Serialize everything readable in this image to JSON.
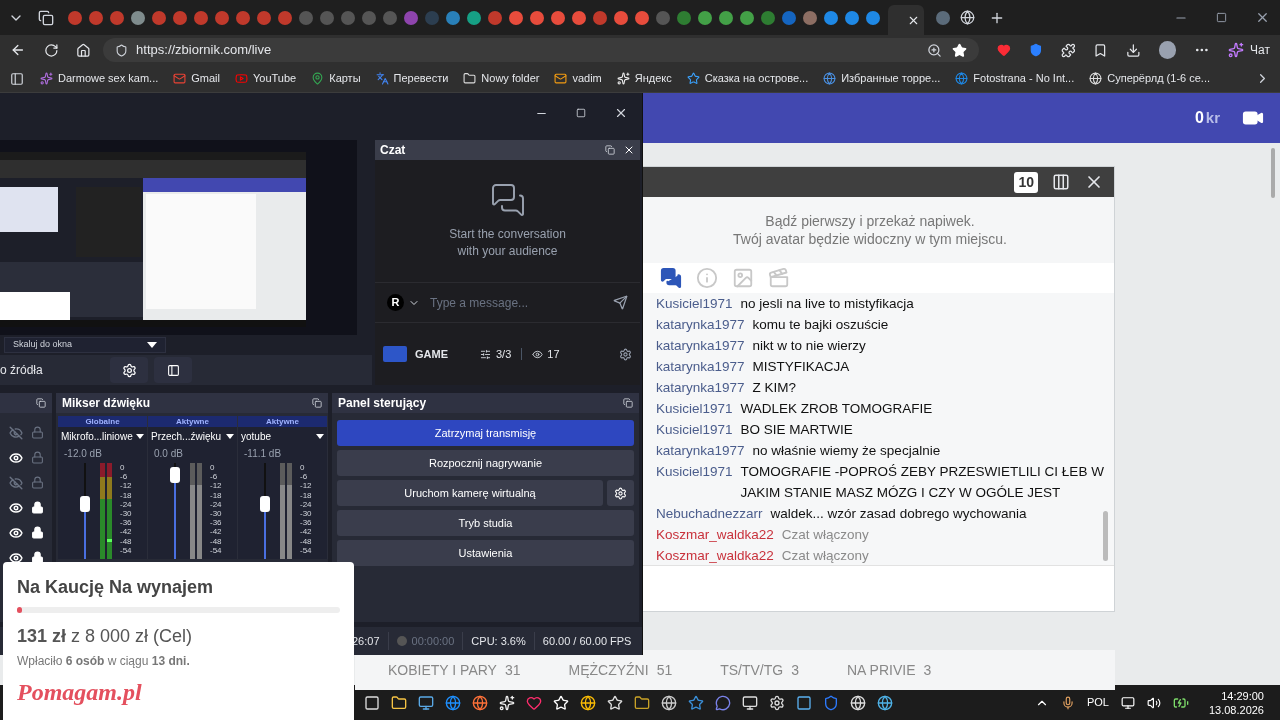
{
  "address_bar": {
    "url": "https://zbiornik.com/live"
  },
  "chat_button": {
    "label": "Чат"
  },
  "bookmarks": [
    {
      "label": "Darmowe sex kam..."
    },
    {
      "label": "Gmail"
    },
    {
      "label": "YouTube"
    },
    {
      "label": "Карты"
    },
    {
      "label": "Перевести"
    },
    {
      "label": "Nowy folder"
    },
    {
      "label": "vadim"
    },
    {
      "label": "Яндекс"
    },
    {
      "label": "Сказка на острове..."
    },
    {
      "label": "Избранные торре..."
    },
    {
      "label": "Fotostrana - No Int..."
    },
    {
      "label": "Суперёрлд (1-6 се..."
    }
  ],
  "page": {
    "header": {
      "balance": "0",
      "currency": "kr"
    },
    "chat_widget": {
      "badge": "10",
      "tip_lines": [
        "Bądź pierwszy i przekaż napiwek.",
        "Twój avatar będzie widoczny w tym miejscu."
      ],
      "tabs": [
        {
          "kind": "chat",
          "selected": true
        },
        {
          "kind": "info",
          "selected": false
        },
        {
          "kind": "image",
          "selected": false
        },
        {
          "kind": "video",
          "selected": false
        }
      ],
      "messages": [
        {
          "kind": "chat",
          "user": "Kusiciel1971",
          "color": "#4b5d8c",
          "text": "no jesli na live to mistyfikacja"
        },
        {
          "kind": "chat",
          "user": "katarynka1977",
          "color": "#4b5d8c",
          "text": "komu te bajki oszuście"
        },
        {
          "kind": "chat",
          "user": "katarynka1977",
          "color": "#4b5d8c",
          "text": "nikt w to nie wierzy"
        },
        {
          "kind": "chat",
          "user": "katarynka1977",
          "color": "#4b5d8c",
          "text": "MISTYFIKACJA"
        },
        {
          "kind": "chat",
          "user": "katarynka1977",
          "color": "#4b5d8c",
          "text": "Z KIM?"
        },
        {
          "kind": "chat",
          "user": "Kusiciel1971",
          "color": "#4b5d8c",
          "text": "WADLEK ZROB TOMOGRAFIE"
        },
        {
          "kind": "chat",
          "user": "Kusiciel1971",
          "color": "#4b5d8c",
          "text": "BO SIE MARTWIE"
        },
        {
          "kind": "chat",
          "user": "katarynka1977",
          "color": "#4b5d8c",
          "text": "no właśnie wiemy że specjalnie"
        },
        {
          "kind": "chat",
          "user": "Kusiciel1971",
          "color": "#4b5d8c",
          "text": "TOMOGRAFIE -POPROŚ ZEBY PRZESWIETLILI CI ŁEB W JAKIM STANIE MASZ MÓZG I CZY W OGÓLE JEST"
        },
        {
          "kind": "chat",
          "user": "Nebuchadnezzarr",
          "color": "#4b5d8c",
          "text": "waldek... wzór zasad dobrego wychowania"
        },
        {
          "kind": "system",
          "user": "Koszmar_waldka22",
          "color": "#c8323c",
          "text": "Czat włączony"
        },
        {
          "kind": "system",
          "user": "Koszmar_waldka22",
          "color": "#c8323c",
          "text": "Czat włączony"
        }
      ]
    },
    "categories": [
      {
        "label": "KOBIETY I PARY",
        "count": "31"
      },
      {
        "label": "MĘŻCZYŹNI",
        "count": "51"
      },
      {
        "label": "TS/TV/TG",
        "count": "3"
      },
      {
        "label": "NA PRIVIE",
        "count": "3"
      }
    ]
  },
  "obs": {
    "scale_mode": "Skaluj do okna",
    "source_label": "o źródła",
    "chat_dock": {
      "title": "Czat",
      "empty_lines": [
        "Start the conversation",
        "with your audience"
      ],
      "avatar": "R",
      "placeholder": "Type a message...",
      "channel": "GAME",
      "streams": "3/3",
      "viewers": "17"
    },
    "sources": [
      {
        "visible": false,
        "locked": false
      },
      {
        "visible": true,
        "locked": false
      },
      {
        "visible": false,
        "locked": false
      },
      {
        "visible": true,
        "locked": true
      },
      {
        "visible": true,
        "locked": true
      },
      {
        "visible": true,
        "locked": true
      }
    ],
    "mixer": {
      "title": "Mikser dźwięku",
      "channels": [
        {
          "group": "Globalne",
          "name": "Mikrofo...liniowe",
          "db": "-12.0 dB",
          "level": 0.6,
          "meter_lit": true,
          "scale": [
            "0",
            "-6",
            "-12",
            "-18",
            "-24",
            "-30",
            "-36",
            "-42",
            "-48",
            "-54"
          ]
        },
        {
          "group": "Aktywne",
          "name": "Przech...źwięku",
          "db": "0.0 dB",
          "level": 0.95,
          "meter_lit": false,
          "scale": [
            "0",
            "-6",
            "-12",
            "-18",
            "-24",
            "-30",
            "-36",
            "-42",
            "-48",
            "-54"
          ]
        },
        {
          "group": "Aktywne",
          "name": "yotube",
          "db": "-11.1 dB",
          "level": 0.6,
          "meter_lit": false,
          "scale": [
            "0",
            "-6",
            "-12",
            "-18",
            "-24",
            "-30",
            "-36",
            "-42",
            "-48",
            "-54"
          ]
        }
      ]
    },
    "controls": {
      "title": "Panel sterujący",
      "buttons": [
        {
          "label": "Zatrzymaj transmisję",
          "active": true,
          "settings": false
        },
        {
          "label": "Rozpocznij nagrywanie",
          "active": false,
          "settings": false
        },
        {
          "label": "Uruchom kamerę wirtualną",
          "active": false,
          "settings": true
        },
        {
          "label": "Tryb studia",
          "active": false,
          "settings": false
        },
        {
          "label": "Ustawienia",
          "active": false,
          "settings": false
        }
      ]
    },
    "status_bar": {
      "stream_time": "26:07",
      "record_time": "00:00:00",
      "cpu": "CPU: 3.6%",
      "fps": "60.00 / 60.00 FPS"
    }
  },
  "fundraiser": {
    "title": "Na Kaucję Na wynajem",
    "level": 0.016,
    "amount": "**131 zł** z 8 000 zł (Cel)",
    "summary": "Wpłaciło **6 osób** w ciągu **13 dni.**",
    "logo": "Pomagam.pl"
  },
  "taskbar": {
    "language": "POL",
    "time": "14:29:00",
    "date": "13.08.2026"
  }
}
